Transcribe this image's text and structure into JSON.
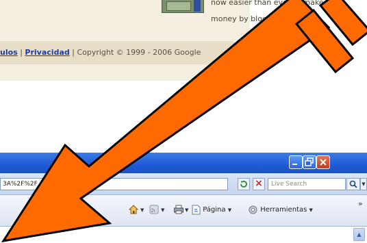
{
  "webpage": {
    "ad_text": [
      "now easier than ever to make",
      "money by blogging."
    ],
    "footer": {
      "links": [
        "ulos",
        "Privacidad"
      ],
      "copyright": "Copyright © 1999 - 2006 Google"
    }
  },
  "browser": {
    "address_text": "3A%2F%2F",
    "search_placeholder": "Live Search",
    "toolbar": {
      "page_label": "Página",
      "tools_label": "Herramientas",
      "more": "»"
    },
    "titlebar_buttons": [
      "minimize",
      "maximize",
      "close"
    ]
  },
  "overlay": {
    "arrow_color": "#ff6a00",
    "arrow_stroke": "#000000",
    "direction": "pointing down-left toward browser toolbar"
  },
  "icons": [
    "home-icon",
    "feed-icon",
    "print-icon",
    "page-icon",
    "tools-gear-icon",
    "search-magnifier-icon",
    "refresh-icon",
    "stop-icon"
  ]
}
